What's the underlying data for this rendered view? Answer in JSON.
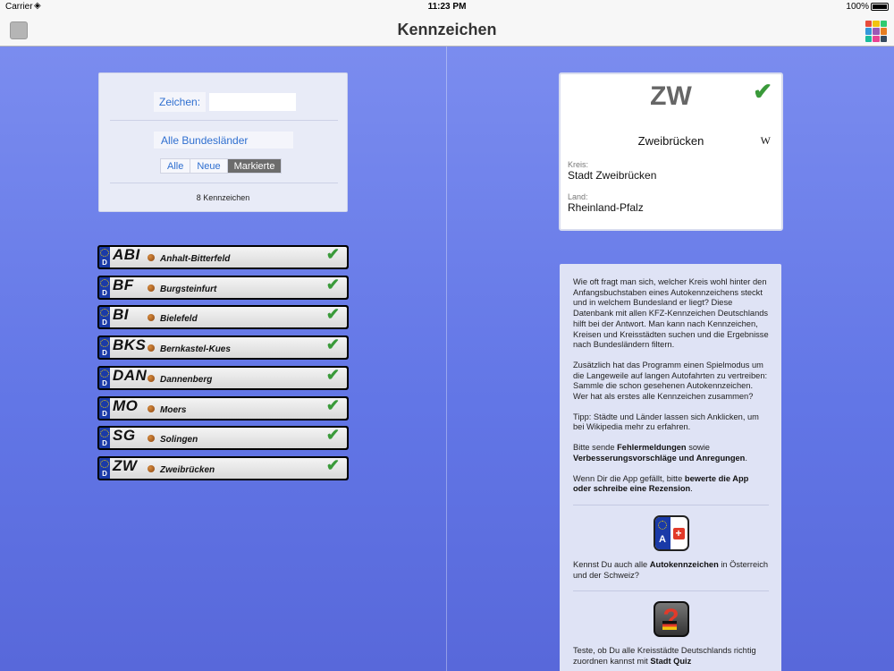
{
  "status": {
    "carrier": "Carrier",
    "time": "11:23 PM",
    "battery": "100%",
    "battery_level": 1.0
  },
  "nav": {
    "title": "Kennzeichen",
    "left_icon": "square-button-icon",
    "right_icon": "color-grid-icon",
    "grid_colors": [
      "#e74c3c",
      "#f1c40f",
      "#2ecc71",
      "#3498db",
      "#9b59b6",
      "#e67e22",
      "#1abc9c",
      "#e84393",
      "#34495e"
    ]
  },
  "search": {
    "label": "Zeichen:",
    "value": "",
    "placeholder": "",
    "state_filter": "Alle Bundesländer",
    "segments": [
      "Alle",
      "Neue",
      "Markierte"
    ],
    "active_segment": "Markierte",
    "count": "8 Kennzeichen"
  },
  "plates": [
    {
      "code": "ABI",
      "name": "Anhalt-Bitterfeld",
      "marked": true
    },
    {
      "code": "BF",
      "name": "Burgsteinfurt",
      "marked": true
    },
    {
      "code": "BI",
      "name": "Bielefeld",
      "marked": true
    },
    {
      "code": "BKS",
      "name": "Bernkastel-Kues",
      "marked": true
    },
    {
      "code": "DAN",
      "name": "Dannenberg",
      "marked": true
    },
    {
      "code": "MO",
      "name": "Moers",
      "marked": true
    },
    {
      "code": "SG",
      "name": "Solingen",
      "marked": true
    },
    {
      "code": "ZW",
      "name": "Zweibrücken",
      "marked": true
    }
  ],
  "plate_country": "D",
  "detail": {
    "code": "ZW",
    "city": "Zweibrücken",
    "wiki": "W",
    "kreis_label": "Kreis:",
    "kreis": "Stadt Zweibrücken",
    "land_label": "Land:",
    "land": "Rheinland-Pfalz"
  },
  "info": {
    "p1": "Wie oft fragt man sich, welcher Kreis wohl hinter den Anfangsbuchstaben eines Autokennzeichens steckt und in welchem Bundesland er liegt? Diese Datenbank mit allen KFZ-Kennzeichen Deutschlands hilft bei der Antwort. Man kann nach Kennzeichen, Kreisen und Kreisstädten suchen und die Ergebnisse nach Bundesländern filtern.",
    "p2": "Zusätzlich hat das Programm einen Spielmodus um die Langeweile auf langen Autofahrten zu vertreiben: Sammle die schon gesehenen Autokennzeichen. Wer hat als erstes alle Kennzeichen zusammen?",
    "p3": "Tipp: Städte und Länder lassen sich Anklicken, um bei Wikipedia mehr zu erfahren.",
    "p4_a": "Bitte sende ",
    "p4_b": "Fehlermeldungen",
    "p4_c": " sowie ",
    "p4_d": "Verbesserungsvorschläge und Anregungen",
    "p4_e": ".",
    "p5_a": "Wenn Dir die App gefällt, bitte ",
    "p5_b": "bewerte die App oder schreibe eine Rezension",
    "p5_c": ".",
    "app1_icon_letter": "A",
    "app1_icon_cross": "+",
    "p6_a": "Kennst Du auch alle ",
    "p6_b": "Autokennzeichen",
    "p6_c": " in Österreich und der Schweiz?",
    "app2_icon_glyph": "?",
    "p7_a": "Teste, ob Du alle Kreisstädte Deutschlands richtig zuordnen kannst mit ",
    "p7_b": "Stadt Quiz"
  }
}
